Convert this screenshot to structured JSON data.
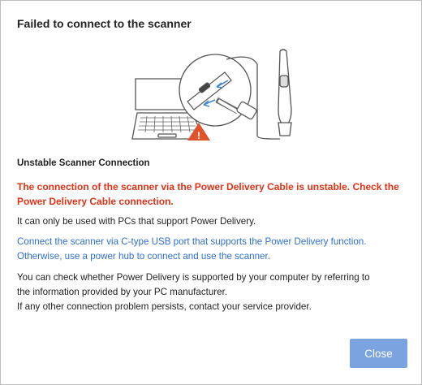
{
  "dialog": {
    "title": "Failed to connect to the scanner",
    "section_title": "Unstable Scanner Connection",
    "warning": "The connection of the scanner via the Power Delivery Cable is unstable. Check the Power Delivery Cable connection.",
    "info_1": "It can only be used with PCs that support Power Delivery.",
    "info_2_line1": "Connect the scanner via C-type USB port that supports the Power Delivery function.",
    "info_2_line2": "Otherwise, use a power hub to connect and use the scanner.",
    "info_3_line1": "You can check whether Power Delivery is supported by your computer by referring to",
    "info_3_line2": "the information provided by your PC manufacturer.",
    "info_3_line3": "If any other connection problem persists, contact your service provider.",
    "close_label": "Close",
    "warning_icon_glyph": "!"
  },
  "colors": {
    "warning": "#e03216",
    "link": "#2f6fd0",
    "button": "#7aa3e0",
    "arrow": "#3b82d6",
    "triangle": "#e0522b"
  },
  "icons": [
    "laptop-illustration",
    "scanner-illustration",
    "warning-triangle-icon",
    "arrow-icon"
  ]
}
